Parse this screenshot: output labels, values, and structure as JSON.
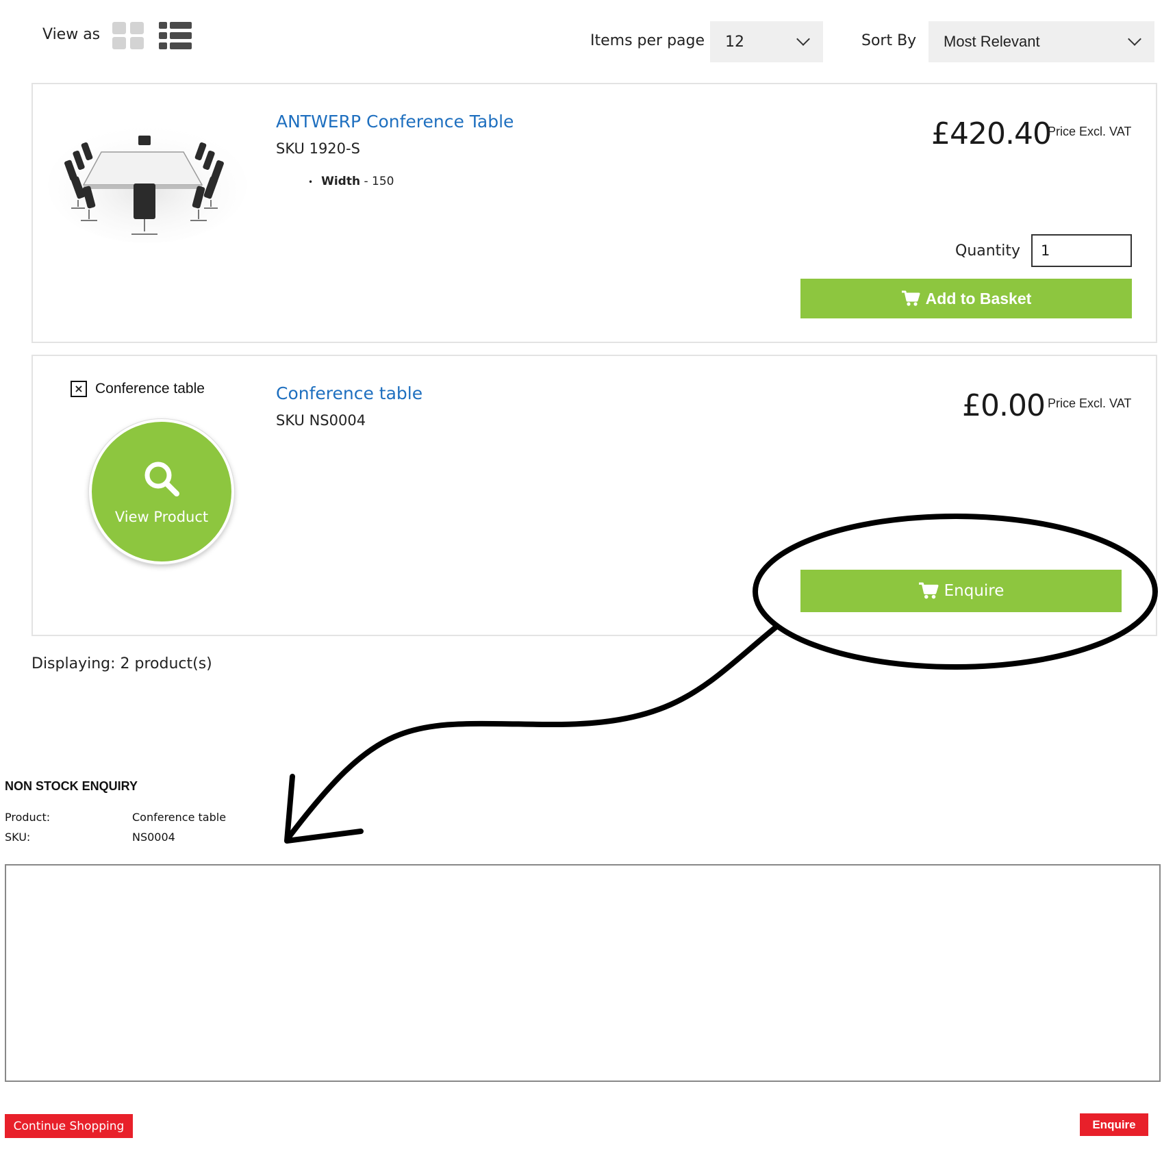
{
  "toolbar": {
    "view_as_label": "View as",
    "items_per_page_label": "Items per page",
    "items_per_page_value": "12",
    "sort_by_label": "Sort By",
    "sort_by_value": "Most Relevant"
  },
  "products": [
    {
      "title": "ANTWERP Conference Table",
      "sku": "SKU 1920-S",
      "spec_name": "Width",
      "spec_value": "- 150",
      "price": "£420.40",
      "price_note": "Price Excl. VAT",
      "quantity_label": "Quantity",
      "quantity_value": "1",
      "button_label": "Add to Basket"
    },
    {
      "image_alt": "Conference table",
      "view_product_label": "View Product",
      "title": "Conference table",
      "sku": "SKU NS0004",
      "price": "£0.00",
      "price_note": "Price Excl. VAT",
      "button_label": "Enquire"
    }
  ],
  "displaying_text": "Displaying: 2 product(s)",
  "enquiry": {
    "title": "NON STOCK ENQUIRY",
    "product_label": "Product:",
    "product_value": "Conference table",
    "sku_label": "SKU:",
    "sku_value": "NS0004",
    "message_value": ""
  },
  "footer_buttons": {
    "continue_label": "Continue Shopping",
    "enquire_label": "Enquire"
  },
  "colors": {
    "accent_green": "#8dc63f",
    "link_blue": "#1e6fbf",
    "button_red": "#e8202a"
  },
  "icons": [
    "grid-view-icon",
    "list-view-icon",
    "chevron-down-icon",
    "cart-icon",
    "search-icon",
    "broken-image-icon"
  ]
}
